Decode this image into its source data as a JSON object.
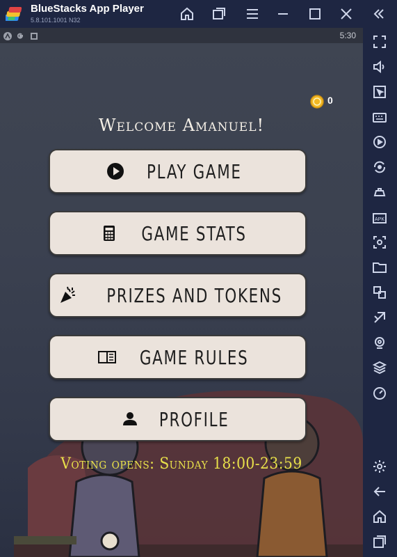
{
  "window": {
    "title": "BlueStacks App Player",
    "version": "5.8.101.1001 N32"
  },
  "statusbar": {
    "time": "5:30"
  },
  "app": {
    "coins": "0",
    "welcome": "Welcome Amanuel!",
    "menu": [
      {
        "label": "PLAY GAME",
        "icon": "play-circle-icon"
      },
      {
        "label": "GAME STATS",
        "icon": "calculator-icon"
      },
      {
        "label": "PRIZES AND TOKENS",
        "icon": "party-popper-icon"
      },
      {
        "label": "GAME RULES",
        "icon": "book-icon"
      },
      {
        "label": "PROFILE",
        "icon": "person-icon"
      }
    ],
    "voting": "Voting opens: Sunday 18:00-23:59"
  },
  "colors": {
    "chrome": "#1e2642",
    "button_bg": "#ebe3dc",
    "voting_text": "#e8e04a",
    "coin": "#f2b824"
  }
}
